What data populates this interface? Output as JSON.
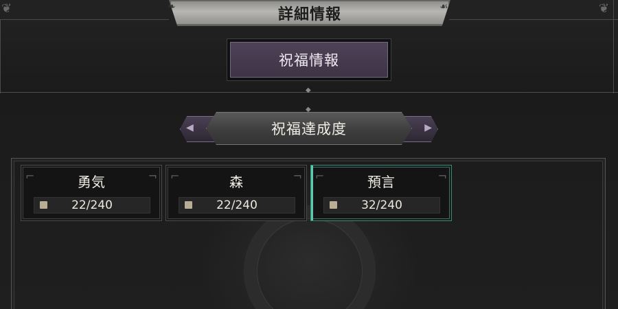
{
  "window": {
    "title": "詳細情報"
  },
  "section_tab": {
    "label": "祝福情報"
  },
  "subsection": {
    "title": "祝福達成度"
  },
  "cards": [
    {
      "name": "勇気",
      "progress": "22/240",
      "current": 22,
      "total": 240,
      "selected": false
    },
    {
      "name": "森",
      "progress": "22/240",
      "current": 22,
      "total": 240,
      "selected": false
    },
    {
      "name": "預言",
      "progress": "32/240",
      "current": 32,
      "total": 240,
      "selected": true
    }
  ],
  "colors": {
    "accent_purple": "#4d4257",
    "selected_teal": "#5fc8ad",
    "title_plate": "#b7b6b2"
  }
}
